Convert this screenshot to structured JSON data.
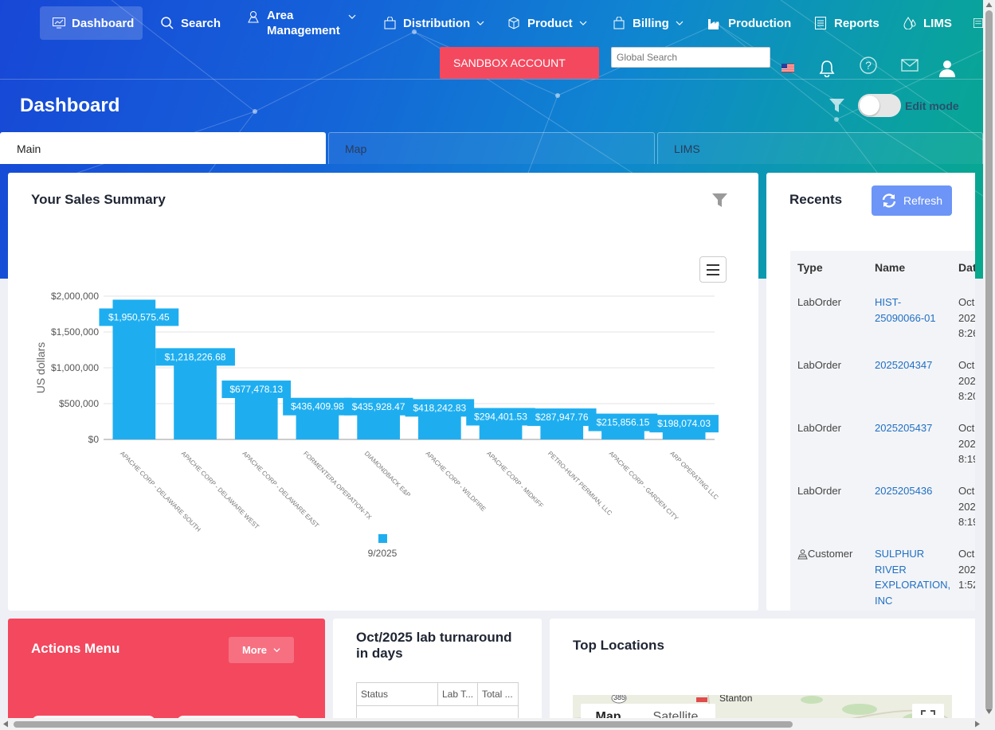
{
  "nav": {
    "items": [
      {
        "label": "Dashboard",
        "icon": "chart-monitor-icon"
      },
      {
        "label": "Search",
        "icon": "search-icon"
      },
      {
        "label": "Area\nManagement",
        "icon": "map-pin-icon"
      },
      {
        "label": "Distribution",
        "icon": "bag-icon"
      },
      {
        "label": "Product",
        "icon": "box-icon"
      },
      {
        "label": "Billing",
        "icon": "cart-icon"
      },
      {
        "label": "Production",
        "icon": "factory-icon"
      },
      {
        "label": "Reports",
        "icon": "document-icon"
      },
      {
        "label": "LIMS",
        "icon": "drops-icon"
      }
    ]
  },
  "header": {
    "sandbox_label": "SANDBOX ACCOUNT",
    "search_placeholder": "Global Search"
  },
  "page": {
    "title": "Dashboard",
    "edit_mode_label": "Edit mode"
  },
  "tabs": [
    {
      "label": "Main"
    },
    {
      "label": "Map"
    },
    {
      "label": "LIMS"
    }
  ],
  "sales": {
    "title": "Your Sales Summary"
  },
  "chart_data": {
    "type": "bar",
    "title": "",
    "ylabel": "US dollars",
    "xlabel": "",
    "ylim": [
      0,
      2000000
    ],
    "yticks": [
      "$0",
      "$500,000",
      "$1,000,000",
      "$1,500,000",
      "$2,000,000"
    ],
    "categories": [
      "APACHE CORP - DELAWARE SOUTH",
      "APACHE CORP - DELAWARE WEST",
      "APACHE CORP - DELAWARE EAST",
      "FORMENTERA OPERATION-TX",
      "DIAMONDBACK E&P",
      "APACHE CORP - WILDFIRE",
      "APACHE CORP - MIDKIFF",
      "PETRO-HUNT PERMIAN, LLC",
      "APACHE CORP - GARDEN CITY",
      "ARP OPERATING LLC"
    ],
    "series": [
      {
        "name": "9/2025",
        "values": [
          1950575.45,
          1218226.68,
          677478.13,
          436409.98,
          435928.47,
          418242.83,
          294401.53,
          287947.76,
          215856.15,
          198074.03
        ]
      }
    ],
    "data_labels": [
      "$1,950,575.45",
      "$1,218,226.68",
      "$677,478.13",
      "$436,409.98",
      "$435,928.47",
      "$418,242.83",
      "$294,401.53",
      "$287,947.76",
      "$215,856.15",
      "$198,074.03"
    ],
    "legend": "bottom-center",
    "color": "#1eaef0",
    "grid": true
  },
  "recents": {
    "title": "Recents",
    "refresh_label": "Refresh",
    "headers": [
      "Type",
      "Name",
      "Dat"
    ],
    "rows": [
      {
        "type": "LabOrder",
        "name": "HIST-\n25090066-01",
        "date": "Oct\n202\n8:26"
      },
      {
        "type": "LabOrder",
        "name": "2025204347",
        "date": "Oct\n202\n8:20"
      },
      {
        "type": "LabOrder",
        "name": "2025205437",
        "date": "Oct\n202\n8:19"
      },
      {
        "type": "LabOrder",
        "name": "2025205436",
        "date": "Oct\n202\n8:19"
      },
      {
        "type": "Customer",
        "name": "SULPHUR\nRIVER\nEXPLORATION,\nINC",
        "date": "Oct\n202\n1:52"
      }
    ]
  },
  "actions": {
    "title": "Actions Menu",
    "more_label": "More"
  },
  "lab": {
    "title": "Oct/2025 lab turnaround in days",
    "headers": [
      "Status",
      "Lab T...",
      "Total ..."
    ]
  },
  "locations": {
    "title": "Top Locations",
    "map_btn": "Map",
    "satellite_btn": "Satellite",
    "place_label": "Stanton",
    "road_label": "385"
  }
}
